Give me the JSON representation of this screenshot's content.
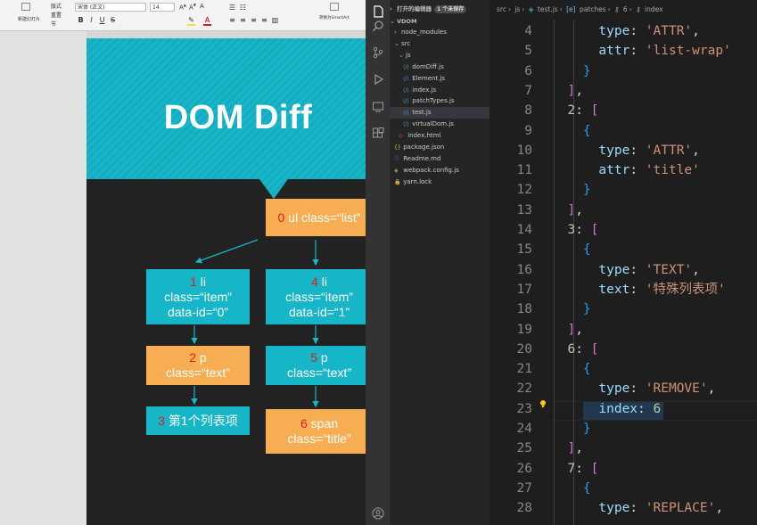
{
  "ppt": {
    "ribbon": {
      "font_name": "宋体 (正文)",
      "font_size": "14",
      "btn_new_slide": "新建幻灯片",
      "btn_layout": "版式",
      "btn_reset": "重置",
      "btn_section": "节",
      "btn_convert": "转换为SmartArt",
      "fmt_bold": "B",
      "fmt_italic": "I",
      "fmt_underline": "U",
      "fmt_strike": "S"
    },
    "slide": {
      "title": "DOM Diff",
      "accent_teal": "#16b6c8",
      "accent_orange": "#f7ae52",
      "nodes": [
        {
          "id": "root",
          "idx": "0",
          "text": " ul class=“list”",
          "color": "orange"
        },
        {
          "id": "li1",
          "idx": "1",
          "text": " li",
          "line2": "class=“item”",
          "line3": "data-id=“0”",
          "color": "teal"
        },
        {
          "id": "li4",
          "idx": "4",
          "text": " li",
          "line2": "class=“item”",
          "line3": "data-id=“1”",
          "color": "teal"
        },
        {
          "id": "p2",
          "idx": "2",
          "text": " p",
          "line2": "class=“text”",
          "color": "orange"
        },
        {
          "id": "p5",
          "idx": "5",
          "text": " p",
          "line2": "class=“text”",
          "color": "teal"
        },
        {
          "id": "t3",
          "idx": "3",
          "text": " 第1个列表项",
          "color": "teal"
        },
        {
          "id": "s6",
          "idx": "6",
          "text": " span",
          "line2": "class=“title”",
          "color": "orange"
        }
      ]
    }
  },
  "vscode": {
    "explorer": {
      "open_editors": "打开的编辑器",
      "unsaved": "1 个未保存",
      "project": "VDOM",
      "items": [
        {
          "label": "node_modules",
          "type": "folder",
          "depth": 1,
          "expanded": false
        },
        {
          "label": "src",
          "type": "folder",
          "depth": 1,
          "expanded": true
        },
        {
          "label": "js",
          "type": "folder",
          "depth": 2,
          "expanded": true
        },
        {
          "label": "domDiff.js",
          "type": "js",
          "depth": 3
        },
        {
          "label": "Element.js",
          "type": "js",
          "depth": 3
        },
        {
          "label": "index.js",
          "type": "js",
          "depth": 3
        },
        {
          "label": "patchTypes.js",
          "type": "js",
          "depth": 3
        },
        {
          "label": "test.js",
          "type": "js",
          "depth": 3,
          "active": true
        },
        {
          "label": "virtualDom.js",
          "type": "js",
          "depth": 3
        },
        {
          "label": "index.html",
          "type": "html",
          "depth": 2
        },
        {
          "label": "package.json",
          "type": "json",
          "depth": 1
        },
        {
          "label": "Readme.md",
          "type": "md",
          "depth": 1
        },
        {
          "label": "webpack.config.js",
          "type": "config",
          "depth": 1
        },
        {
          "label": "yarn.lock",
          "type": "lock",
          "depth": 1
        }
      ]
    },
    "breadcrumb": [
      "src",
      "js",
      "test.js",
      "patches",
      "6",
      "index"
    ],
    "code_lines": [
      {
        "n": "4",
        "tokens": [
          [
            "      ",
            "pun"
          ],
          [
            "type",
            "key"
          ],
          [
            ": ",
            "pun"
          ],
          [
            "'ATTR'",
            "str"
          ],
          [
            ",",
            "pun"
          ]
        ]
      },
      {
        "n": "5",
        "tokens": [
          [
            "      ",
            "pun"
          ],
          [
            "attr",
            "key"
          ],
          [
            ": ",
            "pun"
          ],
          [
            "'list-wrap'",
            "str"
          ]
        ]
      },
      {
        "n": "6",
        "tokens": [
          [
            "    ",
            "pun"
          ],
          [
            "}",
            "br3"
          ]
        ]
      },
      {
        "n": "7",
        "tokens": [
          [
            "  ",
            "pun"
          ],
          [
            "]",
            "br2"
          ],
          [
            ",",
            "pun"
          ]
        ]
      },
      {
        "n": "8",
        "tokens": [
          [
            "  ",
            "pun"
          ],
          [
            "2",
            "num"
          ],
          [
            ": ",
            "pun"
          ],
          [
            "[",
            "br2"
          ]
        ]
      },
      {
        "n": "9",
        "tokens": [
          [
            "    ",
            "pun"
          ],
          [
            "{",
            "br3"
          ]
        ]
      },
      {
        "n": "10",
        "tokens": [
          [
            "      ",
            "pun"
          ],
          [
            "type",
            "key"
          ],
          [
            ": ",
            "pun"
          ],
          [
            "'ATTR'",
            "str"
          ],
          [
            ",",
            "pun"
          ]
        ]
      },
      {
        "n": "11",
        "tokens": [
          [
            "      ",
            "pun"
          ],
          [
            "attr",
            "key"
          ],
          [
            ": ",
            "pun"
          ],
          [
            "'title'",
            "str"
          ]
        ]
      },
      {
        "n": "12",
        "tokens": [
          [
            "    ",
            "pun"
          ],
          [
            "}",
            "br3"
          ]
        ]
      },
      {
        "n": "13",
        "tokens": [
          [
            "  ",
            "pun"
          ],
          [
            "]",
            "br2"
          ],
          [
            ",",
            "pun"
          ]
        ]
      },
      {
        "n": "14",
        "tokens": [
          [
            "  ",
            "pun"
          ],
          [
            "3",
            "num"
          ],
          [
            ": ",
            "pun"
          ],
          [
            "[",
            "br2"
          ]
        ]
      },
      {
        "n": "15",
        "tokens": [
          [
            "    ",
            "pun"
          ],
          [
            "{",
            "br3"
          ]
        ]
      },
      {
        "n": "16",
        "tokens": [
          [
            "      ",
            "pun"
          ],
          [
            "type",
            "key"
          ],
          [
            ": ",
            "pun"
          ],
          [
            "'TEXT'",
            "str"
          ],
          [
            ",",
            "pun"
          ]
        ]
      },
      {
        "n": "17",
        "tokens": [
          [
            "      ",
            "pun"
          ],
          [
            "text",
            "key"
          ],
          [
            ": ",
            "pun"
          ],
          [
            "'特殊列表项'",
            "str"
          ]
        ]
      },
      {
        "n": "18",
        "tokens": [
          [
            "    ",
            "pun"
          ],
          [
            "}",
            "br3"
          ]
        ]
      },
      {
        "n": "19",
        "tokens": [
          [
            "  ",
            "pun"
          ],
          [
            "]",
            "br2"
          ],
          [
            ",",
            "pun"
          ]
        ]
      },
      {
        "n": "20",
        "tokens": [
          [
            "  ",
            "pun"
          ],
          [
            "6",
            "num"
          ],
          [
            ": ",
            "pun"
          ],
          [
            "[",
            "br2"
          ]
        ]
      },
      {
        "n": "21",
        "tokens": [
          [
            "    ",
            "pun"
          ],
          [
            "{",
            "br3"
          ]
        ]
      },
      {
        "n": "22",
        "tokens": [
          [
            "      ",
            "pun"
          ],
          [
            "type",
            "key"
          ],
          [
            ": ",
            "pun"
          ],
          [
            "'REMOVE'",
            "str"
          ],
          [
            ",",
            "pun"
          ]
        ]
      },
      {
        "n": "23",
        "tokens": [
          [
            "      ",
            "pun"
          ],
          [
            "index",
            "key"
          ],
          [
            ": ",
            "pun"
          ],
          [
            "6",
            "num"
          ]
        ]
      },
      {
        "n": "24",
        "tokens": [
          [
            "    ",
            "pun"
          ],
          [
            "}",
            "br3"
          ]
        ]
      },
      {
        "n": "25",
        "tokens": [
          [
            "  ",
            "pun"
          ],
          [
            "]",
            "br2"
          ],
          [
            ",",
            "pun"
          ]
        ]
      },
      {
        "n": "26",
        "tokens": [
          [
            "  ",
            "pun"
          ],
          [
            "7",
            "num"
          ],
          [
            ": ",
            "pun"
          ],
          [
            "[",
            "br2"
          ]
        ]
      },
      {
        "n": "27",
        "tokens": [
          [
            "    ",
            "pun"
          ],
          [
            "{",
            "br3"
          ]
        ]
      },
      {
        "n": "28",
        "tokens": [
          [
            "      ",
            "pun"
          ],
          [
            "type",
            "key"
          ],
          [
            ": ",
            "pun"
          ],
          [
            "'REPLACE'",
            "str"
          ],
          [
            ",",
            "pun"
          ]
        ]
      }
    ]
  }
}
